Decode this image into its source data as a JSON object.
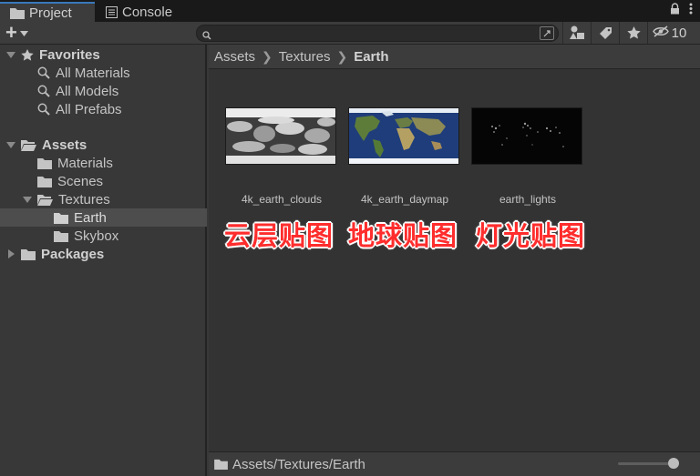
{
  "tabs": [
    {
      "label": "Project",
      "icon": "folder-icon",
      "active": true
    },
    {
      "label": "Console",
      "icon": "console-icon",
      "active": false
    }
  ],
  "toolbar": {
    "create_label": "+",
    "search_value": "",
    "hidden_count": "10"
  },
  "tree": {
    "favorites": {
      "label": "Favorites",
      "items": [
        "All Materials",
        "All Models",
        "All Prefabs"
      ]
    },
    "assets": {
      "label": "Assets",
      "folders": [
        "Materials",
        "Scenes",
        "Textures"
      ],
      "textures_children": [
        "Earth",
        "Skybox"
      ]
    },
    "packages": {
      "label": "Packages"
    }
  },
  "breadcrumb": [
    "Assets",
    "Textures",
    "Earth"
  ],
  "assets": [
    {
      "name": "4k_earth_clouds",
      "annotation": "云层贴图"
    },
    {
      "name": "4k_earth_daymap",
      "annotation": "地球贴图"
    },
    {
      "name": "earth_lights",
      "annotation": "灯光贴图"
    }
  ],
  "footer": {
    "path": "Assets/Textures/Earth",
    "zoom_slider_fraction": 0.9
  },
  "colors": {
    "accent": "#3a79bb",
    "annotation": "#ff2d2d",
    "selected_row": "#4d4d4d"
  }
}
